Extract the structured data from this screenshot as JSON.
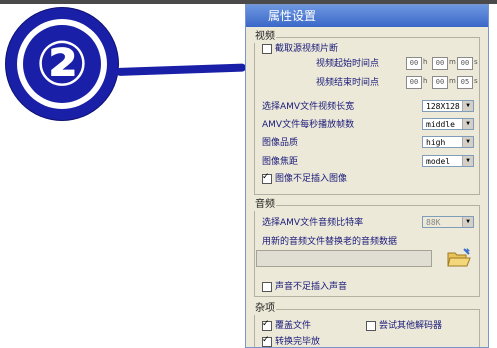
{
  "callout": {
    "number": "②"
  },
  "dialog": {
    "title": "属性设置",
    "video": {
      "group_label": "视频",
      "cut_source_label": "截取源视频片断",
      "start_label": "视频起始时间点",
      "end_label": "视频结束时间点",
      "start_time": {
        "h": "00",
        "m": "00",
        "s": "00"
      },
      "end_time": {
        "h": "00",
        "m": "00",
        "s": "05"
      },
      "unit_h": "h",
      "unit_m": "m",
      "unit_s": "s",
      "size_label": "选择AMV文件视频长宽",
      "size_value": "128X128",
      "fps_label": "AMV文件每秒播放帧数",
      "fps_value": "middle",
      "quality_label": "图像品质",
      "quality_value": "high",
      "focus_label": "图像焦距",
      "focus_value": "model",
      "no_fill_image_label": "图像不足插入图像"
    },
    "audio": {
      "group_label": "音频",
      "bitrate_label": "选择AMV文件音频比特率",
      "bitrate_value": "88K",
      "replace_label": "用新的音频文件替换老的音频数据",
      "replace_path": "",
      "no_fill_audio_label": "声音不足插入声音"
    },
    "misc": {
      "group_label": "杂项",
      "overwrite_label": "覆盖文件",
      "try_other_decoder_label": "尝试其他解码器",
      "convert_done_label": "转换完毕放"
    }
  },
  "colors": {
    "marker": "#1a1fa8",
    "dialog_bg": "#ece9d8",
    "title_bar": "#3a67c8"
  }
}
